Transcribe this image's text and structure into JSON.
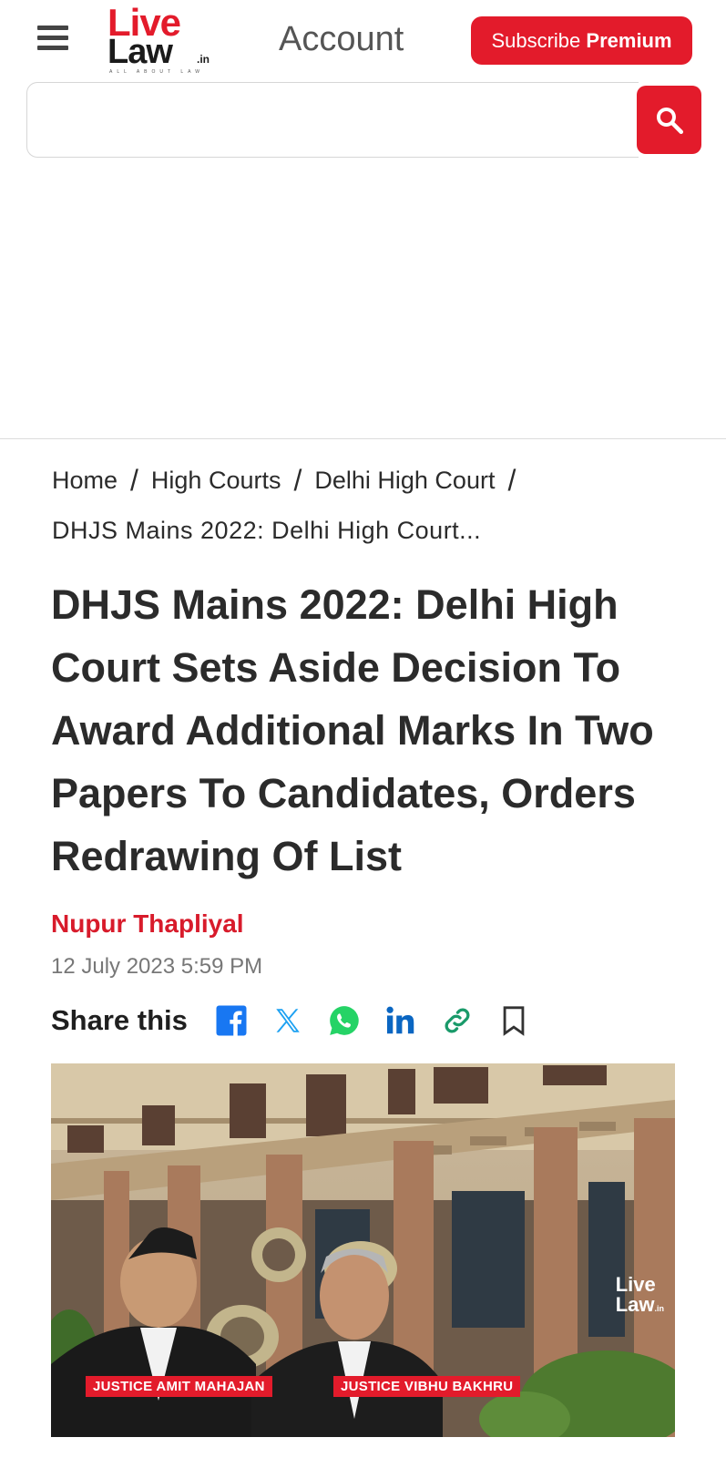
{
  "header": {
    "logo_live": "Live",
    "logo_law": "Law",
    "logo_in": ".in",
    "logo_tagline": "ALL ABOUT LAW",
    "account_label": "Account",
    "subscribe_prefix": "Subscribe",
    "subscribe_emphasis": "Premium"
  },
  "search": {
    "value": "",
    "placeholder": ""
  },
  "breadcrumb": {
    "items": [
      "Home",
      "High Courts",
      "Delhi High Court"
    ],
    "separator": "/",
    "current": "DHJS Mains 2022: Delhi High Court..."
  },
  "article": {
    "title": "DHJS Mains 2022: Delhi High Court Sets Aside Decision To Award Additional Marks In Two Papers To Candidates, Orders Redrawing Of List",
    "author": "Nupur Thapliyal",
    "date": "12 July 2023 5:59 PM",
    "share_label": "Share this"
  },
  "share_icons": [
    "facebook-icon",
    "x-icon",
    "whatsapp-icon",
    "linkedin-icon",
    "link-icon",
    "bookmark-icon"
  ],
  "hero": {
    "caption_left": "JUSTICE AMIT MAHAJAN",
    "caption_right": "JUSTICE VIBHU BAKHRU",
    "watermark_live": "Live",
    "watermark_law": "Law",
    "watermark_in": ".in"
  },
  "colors": {
    "brand_red": "#e31b2b",
    "author_red": "#d81b2b",
    "text_dark": "#2b2b2b",
    "muted": "#777777",
    "facebook": "#1877f2",
    "x": "#1da1f2",
    "whatsapp": "#25d366",
    "linkedin": "#0a66c2",
    "link": "#1a9a6a"
  }
}
